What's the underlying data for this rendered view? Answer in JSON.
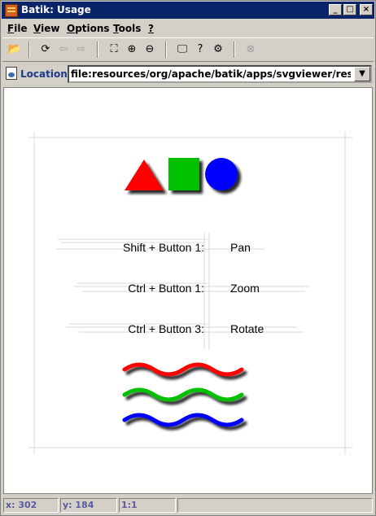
{
  "window": {
    "title": "Batik: Usage",
    "minimize": "_",
    "maximize": "□",
    "close": "×"
  },
  "menu": {
    "file": {
      "u": "F",
      "rest": "ile"
    },
    "view": {
      "u": "V",
      "rest": "iew"
    },
    "options": {
      "u": "O",
      "rest": "ptions"
    },
    "tools": {
      "u": "T",
      "rest": "ools"
    },
    "help": {
      "u": "?",
      "rest": ""
    }
  },
  "toolbar": {
    "open": "📂",
    "reload": "⟳",
    "back": "⇦",
    "forward": "⇨",
    "fit": "⛶",
    "zoom_in": "⊕",
    "zoom_out": "⊖",
    "view_source": "🖵",
    "document_info": "?",
    "dom_viewer": "⚙",
    "stop": "⊗"
  },
  "location": {
    "label": "Location:",
    "value": "file:resources/org/apache/batik/apps/svgviewer/resources/usage.svg",
    "drop": "▼"
  },
  "usage": {
    "rows": [
      {
        "combo": "Shift + Button 1:",
        "action": "Pan"
      },
      {
        "combo": "Ctrl + Button 1:",
        "action": "Zoom"
      },
      {
        "combo": "Ctrl + Button 3:",
        "action": "Rotate"
      }
    ],
    "colors": {
      "red": "#ff0000",
      "green": "#00c000",
      "blue": "#0000ff"
    }
  },
  "status": {
    "x": "x: 302",
    "y": "y: 184",
    "zoom": "1:1",
    "message": ""
  }
}
